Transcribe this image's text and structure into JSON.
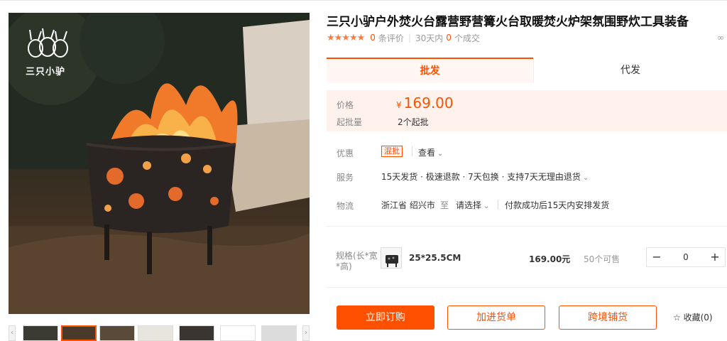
{
  "product": {
    "title": "三只小驴户外焚火台露营野营篝火台取暖焚火炉架氛围野炊工具装备",
    "brand_logo_text": "三只小驴",
    "stars": "★★★★★",
    "review_count": "0",
    "review_suffix": "条评价",
    "deals_prefix": "30天内",
    "deals_count": "0",
    "deals_suffix": "个成交",
    "side_char": "∞"
  },
  "tabs": {
    "wholesale": "批发",
    "dropship": "代发"
  },
  "price_box": {
    "price_label": "价格",
    "currency": "¥",
    "price": "169.00",
    "moq_label": "起批量",
    "moq_value": "2个起批"
  },
  "promo": {
    "label": "优惠",
    "tag": "混批",
    "view": "查看"
  },
  "service": {
    "label": "服务",
    "value": "15天发货 · 极速退款 · 7天包换 · 支持7天无理由退货"
  },
  "logistics": {
    "label": "物流",
    "origin": "浙江省 绍兴市",
    "to": "至",
    "dest": "请选择",
    "ship_note": "付款成功后15天内安排发货"
  },
  "spec": {
    "label": "规格(长*宽*高)",
    "name": "25*25.5CM",
    "price": "169.00元",
    "stock": "50个可售",
    "qty": "0",
    "minus": "−",
    "plus": "+"
  },
  "actions": {
    "buy": "立即订购",
    "cart": "加进货单",
    "cross": "跨境铺货",
    "fav": "☆ 收藏(0)"
  },
  "thumb_arrows": {
    "left": "‹",
    "right": "›"
  },
  "colors": {
    "accent": "#ff5000",
    "star": "#ff7a3d",
    "price_bg": "#fff2ec"
  }
}
